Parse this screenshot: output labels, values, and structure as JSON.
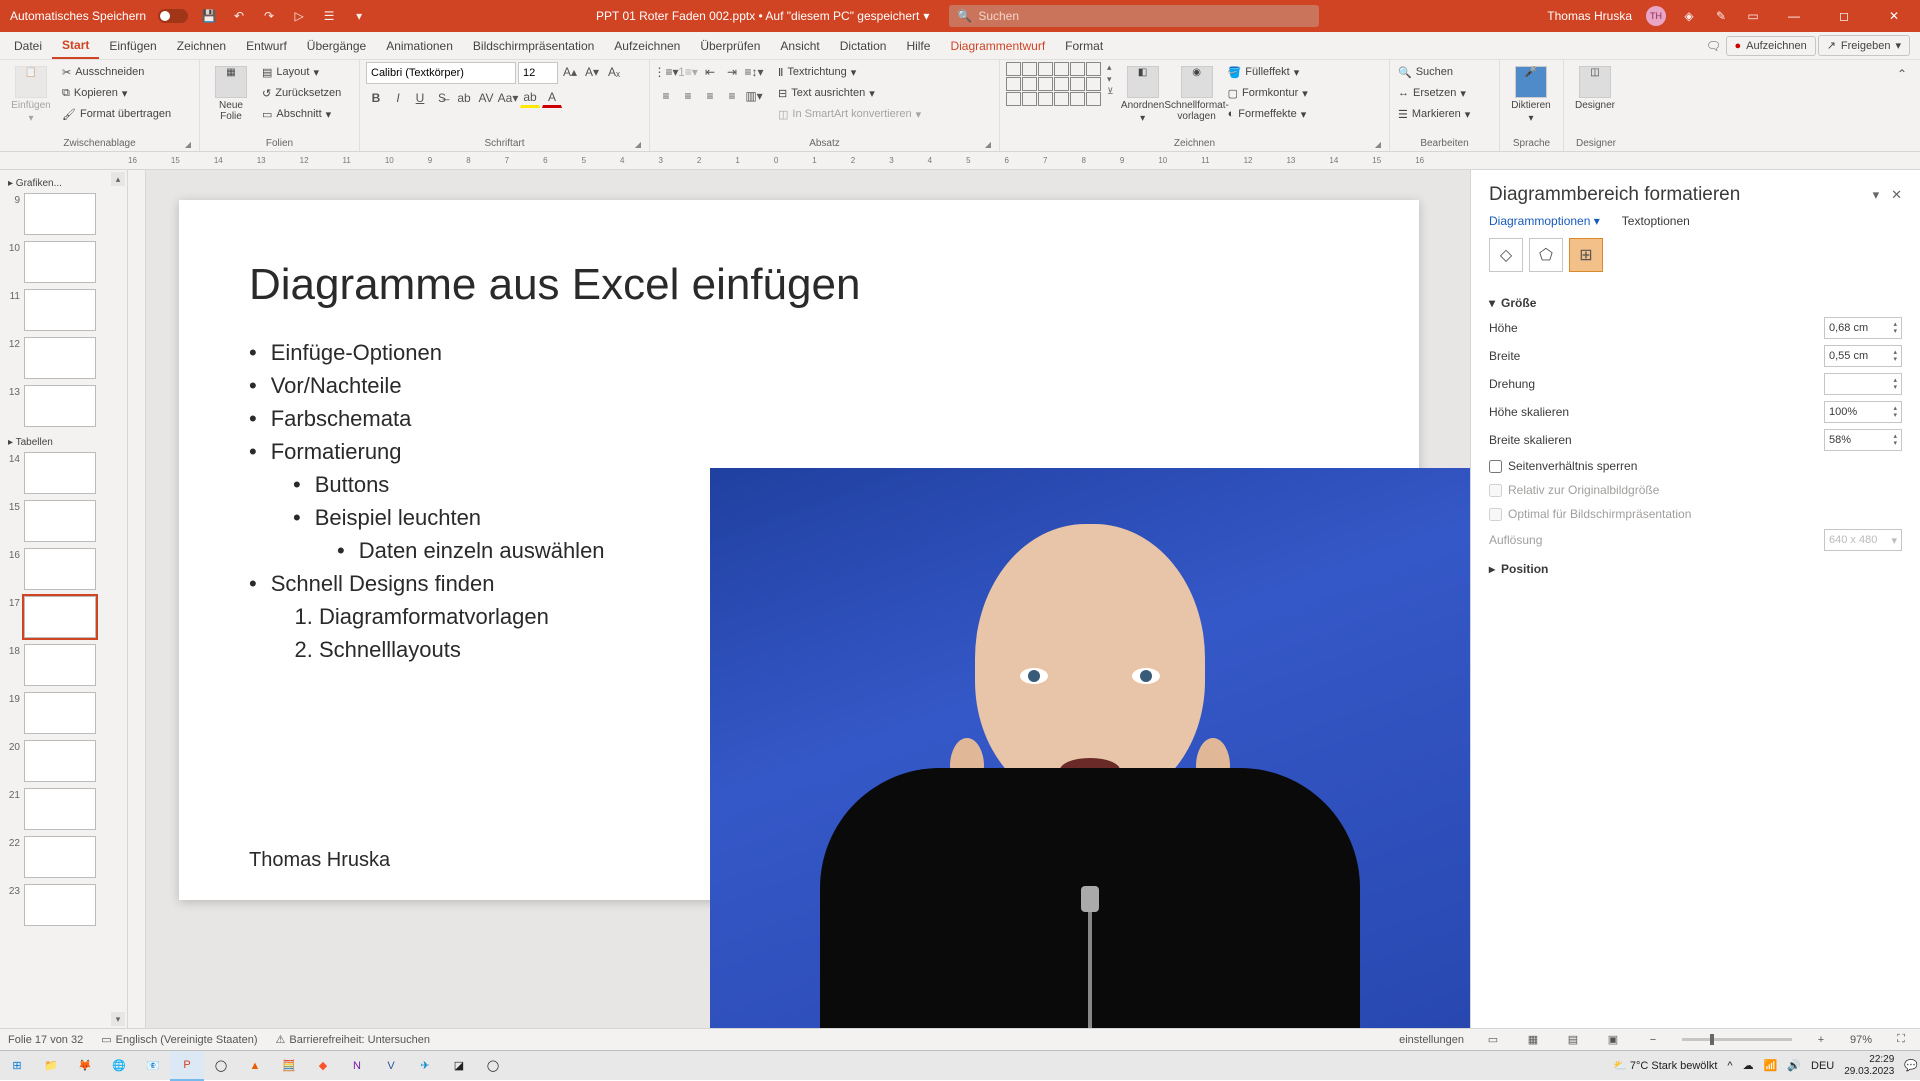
{
  "titlebar": {
    "autosave": "Automatisches Speichern",
    "filename": "PPT 01 Roter Faden 002.pptx • Auf \"diesem PC\" gespeichert",
    "search_placeholder": "Suchen",
    "user_name": "Thomas Hruska",
    "user_initials": "TH"
  },
  "tabs": {
    "items": [
      "Datei",
      "Start",
      "Einfügen",
      "Zeichnen",
      "Entwurf",
      "Übergänge",
      "Animationen",
      "Bildschirmpräsentation",
      "Aufzeichnen",
      "Überprüfen",
      "Ansicht",
      "Dictation",
      "Hilfe",
      "Diagrammentwurf",
      "Format"
    ],
    "active": "Start",
    "record": "Aufzeichnen",
    "share": "Freigeben"
  },
  "ribbon": {
    "paste": "Einfügen",
    "cut": "Ausschneiden",
    "copy": "Kopieren",
    "format_painter": "Format übertragen",
    "clipboard_label": "Zwischenablage",
    "new_slide": "Neue\nFolie",
    "layout": "Layout",
    "reset": "Zurücksetzen",
    "section": "Abschnitt",
    "slides_label": "Folien",
    "font_name": "Calibri (Textkörper)",
    "font_size": "12",
    "font_label": "Schriftart",
    "paragraph_label": "Absatz",
    "text_dir": "Textrichtung",
    "align_text": "Text ausrichten",
    "smartart": "In SmartArt konvertieren",
    "arrange": "Anordnen",
    "quick_styles": "Schnellformat-\nvorlagen",
    "shape_fill": "Fülleffekt",
    "shape_outline": "Formkontur",
    "shape_effects": "Formeffekte",
    "drawing_label": "Zeichnen",
    "find": "Suchen",
    "replace": "Ersetzen",
    "select": "Markieren",
    "editing_label": "Bearbeiten",
    "dictate": "Diktieren",
    "voice_label": "Sprache",
    "designer": "Designer",
    "designer_label": "Designer"
  },
  "ruler_ticks": [
    "16",
    "15",
    "14",
    "13",
    "12",
    "11",
    "10",
    "9",
    "8",
    "7",
    "6",
    "5",
    "4",
    "3",
    "2",
    "1",
    "0",
    "1",
    "2",
    "3",
    "4",
    "5",
    "6",
    "7",
    "8",
    "9",
    "10",
    "11",
    "12",
    "13",
    "14",
    "15",
    "16"
  ],
  "thumbs": {
    "section1": "Grafiken...",
    "section2": "Tabellen",
    "slides1": [
      "9",
      "10",
      "11",
      "12",
      "13"
    ],
    "slides2": [
      "14",
      "15",
      "16",
      "17",
      "18",
      "19",
      "20",
      "21",
      "22",
      "23"
    ],
    "selected": "17"
  },
  "slide": {
    "title": "Diagramme aus Excel einfügen",
    "bullets_l1": [
      "Einfüge-Optionen",
      "Vor/Nachteile",
      "Farbschemata",
      "Formatierung"
    ],
    "bullets_l2": [
      "Buttons",
      "Beispiel leuchten"
    ],
    "bullets_l3": [
      "Daten einzeln auswählen"
    ],
    "bullets_l1b": [
      "Schnell Designs finden"
    ],
    "ordered": [
      "Diagramformatvorlagen",
      "Schnelllayouts"
    ],
    "author": "Thomas Hruska"
  },
  "pane": {
    "title": "Diagrammbereich formatieren",
    "tab1": "Diagrammoptionen",
    "tab2": "Textoptionen",
    "size_section": "Größe",
    "height": "Höhe",
    "height_val": "0,68 cm",
    "width": "Breite",
    "width_val": "0,55 cm",
    "rotation": "Drehung",
    "scale_h": "Höhe skalieren",
    "scale_h_val": "100%",
    "scale_w": "Breite skalieren",
    "scale_w_val": "58%",
    "lock_ratio": "Seitenverhältnis sperren",
    "rel_original": "Relativ zur Originalbildgröße",
    "optimal_slideshow": "Optimal für Bildschirmpräsentation",
    "resolution": "Auflösung",
    "resolution_val": "640 x 480",
    "position_section": "Position"
  },
  "status": {
    "slide_of": "Folie 17 von 32",
    "language": "Englisch (Vereinigte Staaten)",
    "accessibility": "Barrierefreiheit: Untersuchen",
    "einstellungen": "einstellungen",
    "zoom": "97%"
  },
  "taskbar": {
    "weather_temp": "7°C",
    "weather_desc": "Stark bewölkt",
    "lang": "DEU",
    "time": "22:29",
    "date": "29.03.2023"
  }
}
